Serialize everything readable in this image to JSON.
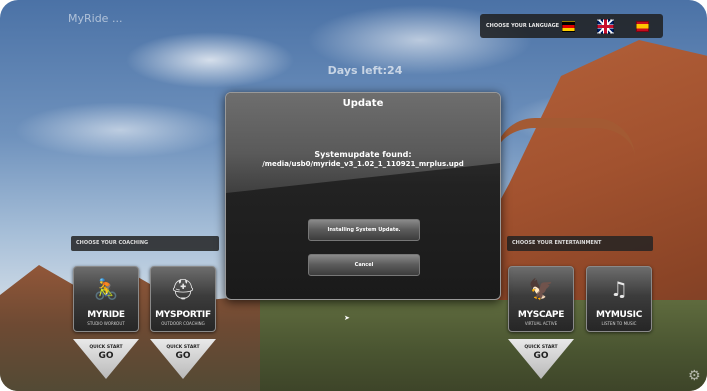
{
  "header": {
    "brand": "MyRide ...",
    "days_left": "Days left:24",
    "language_label": "CHOOSE YOUR LANGUAGE",
    "flags": [
      "german-flag-icon",
      "uk-flag-icon",
      "spanish-flag-icon"
    ]
  },
  "coaching": {
    "label": "CHOOSE YOUR COACHING",
    "tiles": [
      {
        "icon": "bike-icon",
        "name": "MYRIDE",
        "sub": "STUDIO WORKOUT"
      },
      {
        "icon": "helmet-icon",
        "name": "MYSPORTIF",
        "sub": "OUTDOOR COACHING"
      }
    ]
  },
  "entertainment": {
    "label": "CHOOSE YOUR ENTERTAINMENT",
    "tiles": [
      {
        "icon": "eagle-icon",
        "name": "MYSCAPE",
        "sub": "VIRTUAL ACTIVE"
      },
      {
        "icon": "music-note-icon",
        "name": "MYMUSIC",
        "sub": "LISTEN TO MUSIC"
      }
    ]
  },
  "quickstart": {
    "line1": "QUICK START",
    "line2": "GO"
  },
  "dialog": {
    "title": "Update",
    "message_line1": "Systemupdate found:",
    "message_line2": "/media/usb0/myride_v3_1.02_1_110921_mrplus.upd",
    "install_button": "Installing System Update.",
    "cancel_button": "Cancel"
  },
  "glyphs": {
    "bike": "🚴",
    "helmet": "⛑",
    "eagle": "🦅",
    "music": "♫",
    "gear": "⚙",
    "cursor": "➤"
  }
}
